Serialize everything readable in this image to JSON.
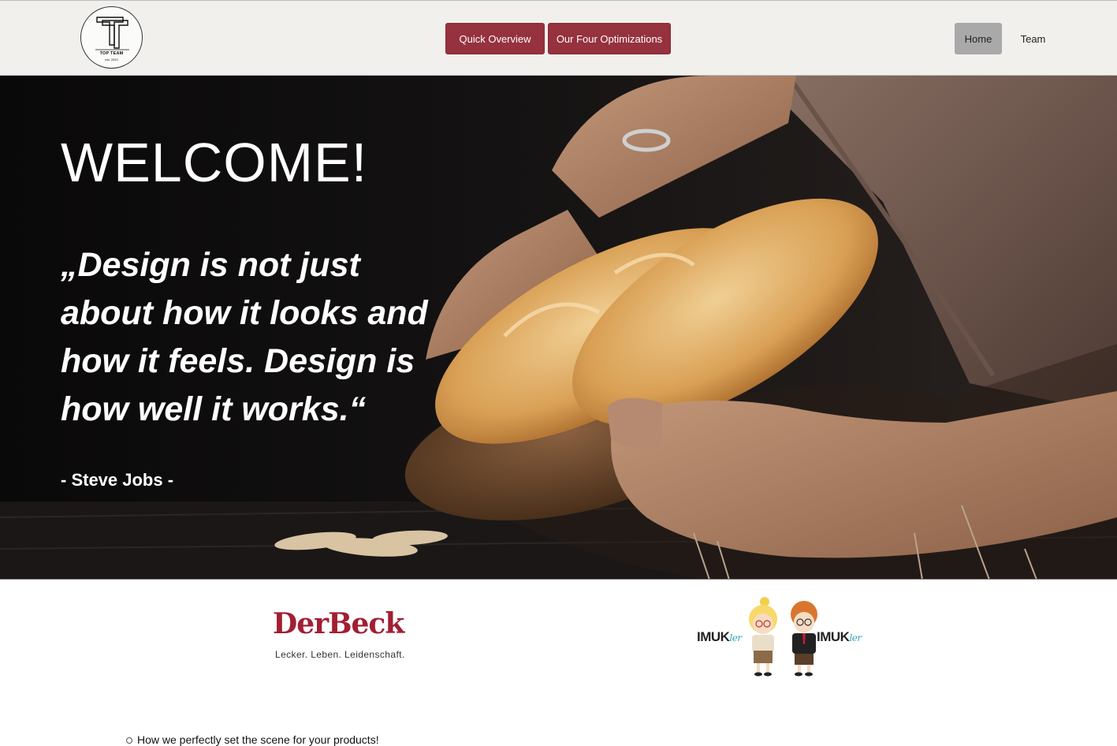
{
  "header": {
    "logo": {
      "name": "TOP TEAM",
      "est": "est. 2020"
    },
    "nav_buttons": [
      "Quick Overview",
      "Our Four Optimizations"
    ],
    "nav_links": [
      "Home",
      "Team"
    ]
  },
  "hero": {
    "title": "WELCOME!",
    "quote": "„Design is not just about how it looks and how it feels. Design is how well it works.“",
    "author": "- Steve Jobs -"
  },
  "partners": {
    "derbeck": {
      "name": "DerBeck",
      "slogan": "Lecker. Leben. Leidenschaft."
    },
    "imukler": {
      "left_main": "IMUK",
      "left_suffix": "ler",
      "right_main": "IMUK",
      "right_suffix": "ler"
    }
  },
  "content": {
    "bullet_text": "How we perfectly set the scene for your products!"
  },
  "colors": {
    "accent": "#96313e",
    "header_bg": "#f1f0ec",
    "home_active": "#a9a9a9"
  }
}
